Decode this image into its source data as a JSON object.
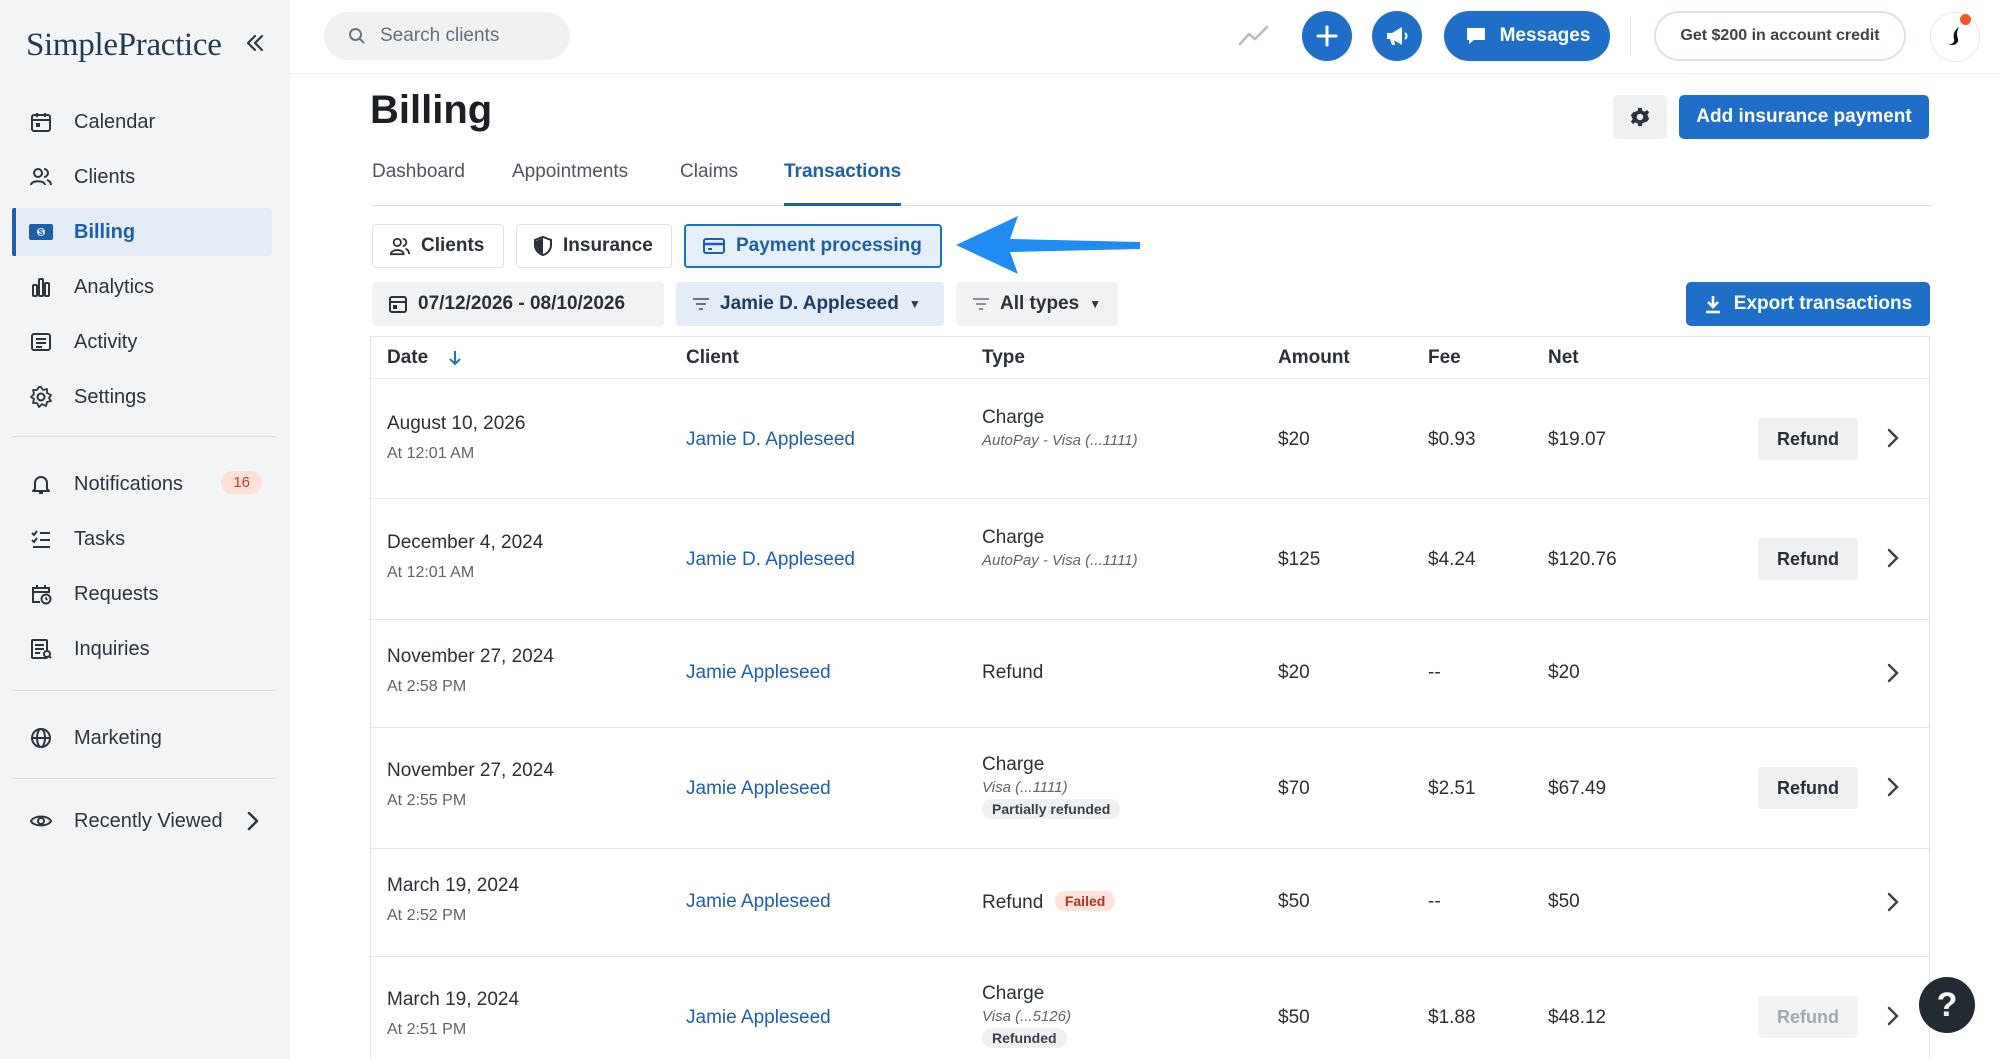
{
  "app": {
    "brand": "SimplePractice"
  },
  "sidebar": {
    "items": [
      {
        "label": "Calendar",
        "icon": "calendar-icon"
      },
      {
        "label": "Clients",
        "icon": "users-icon"
      },
      {
        "label": "Billing",
        "icon": "billing-icon",
        "active": true
      },
      {
        "label": "Analytics",
        "icon": "bar-chart-icon"
      },
      {
        "label": "Activity",
        "icon": "activity-list-icon"
      },
      {
        "label": "Settings",
        "icon": "gear-icon"
      }
    ],
    "secondary": [
      {
        "label": "Notifications",
        "icon": "bell-icon",
        "badge": "16"
      },
      {
        "label": "Tasks",
        "icon": "tasks-icon"
      },
      {
        "label": "Requests",
        "icon": "calendar-clock-icon"
      },
      {
        "label": "Inquiries",
        "icon": "inquiries-icon"
      }
    ],
    "marketing": {
      "label": "Marketing",
      "icon": "globe-icon"
    },
    "recently_viewed": {
      "label": "Recently Viewed",
      "icon": "eye-icon"
    }
  },
  "topbar": {
    "search_placeholder": "Search clients",
    "messages_label": "Messages",
    "credit_label": "Get $200 in account credit"
  },
  "page": {
    "title": "Billing",
    "add_insurance_label": "Add insurance payment",
    "tabs": [
      "Dashboard",
      "Appointments",
      "Claims",
      "Transactions"
    ],
    "active_tab": "Transactions",
    "segments": [
      "Clients",
      "Insurance",
      "Payment processing"
    ],
    "active_segment": "Payment processing",
    "filters": {
      "date_range": "07/12/2026 - 08/10/2026",
      "client": "Jamie D. Appleseed",
      "types": "All types"
    },
    "export_label": "Export transactions"
  },
  "table": {
    "columns": [
      "Date",
      "Client",
      "Type",
      "Amount",
      "Fee",
      "Net"
    ],
    "rows": [
      {
        "date": "August 10, 2026",
        "time": "At 12:01 AM",
        "client": "Jamie D. Appleseed",
        "type": "Charge",
        "type_detail": "AutoPay - Visa (...1111)",
        "status": "",
        "amount": "$20",
        "fee": "$0.93",
        "net": "$19.07",
        "refund": "Refund",
        "refund_enabled": true
      },
      {
        "date": "December 4, 2024",
        "time": "At 12:01 AM",
        "client": "Jamie D. Appleseed",
        "type": "Charge",
        "type_detail": "AutoPay - Visa (...1111)",
        "status": "",
        "amount": "$125",
        "fee": "$4.24",
        "net": "$120.76",
        "refund": "Refund",
        "refund_enabled": true
      },
      {
        "date": "November 27, 2024",
        "time": "At 2:58 PM",
        "client": "Jamie Appleseed",
        "type": "Refund",
        "type_detail": "",
        "status": "",
        "amount": "$20",
        "fee": "--",
        "net": "$20",
        "refund": "",
        "refund_enabled": false
      },
      {
        "date": "November 27, 2024",
        "time": "At 2:55 PM",
        "client": "Jamie Appleseed",
        "type": "Charge",
        "type_detail": "Visa (...1111)",
        "status": "Partially refunded",
        "amount": "$70",
        "fee": "$2.51",
        "net": "$67.49",
        "refund": "Refund",
        "refund_enabled": true
      },
      {
        "date": "March 19, 2024",
        "time": "At 2:52 PM",
        "client": "Jamie Appleseed",
        "type": "Refund",
        "type_detail": "",
        "status": "Failed",
        "amount": "$50",
        "fee": "--",
        "net": "$50",
        "refund": "",
        "refund_enabled": false
      },
      {
        "date": "March 19, 2024",
        "time": "At 2:51 PM",
        "client": "Jamie Appleseed",
        "type": "Charge",
        "type_detail": "Visa (...5126)",
        "status": "Refunded",
        "amount": "$50",
        "fee": "$1.88",
        "net": "$48.12",
        "refund": "Refund",
        "refund_enabled": false
      }
    ]
  },
  "help": {
    "label": "?"
  },
  "colors": {
    "accent": "#1f6fc8",
    "arrow": "#1e8cf0",
    "badge_bg": "#fde0d8",
    "failed": "#b3341c"
  }
}
